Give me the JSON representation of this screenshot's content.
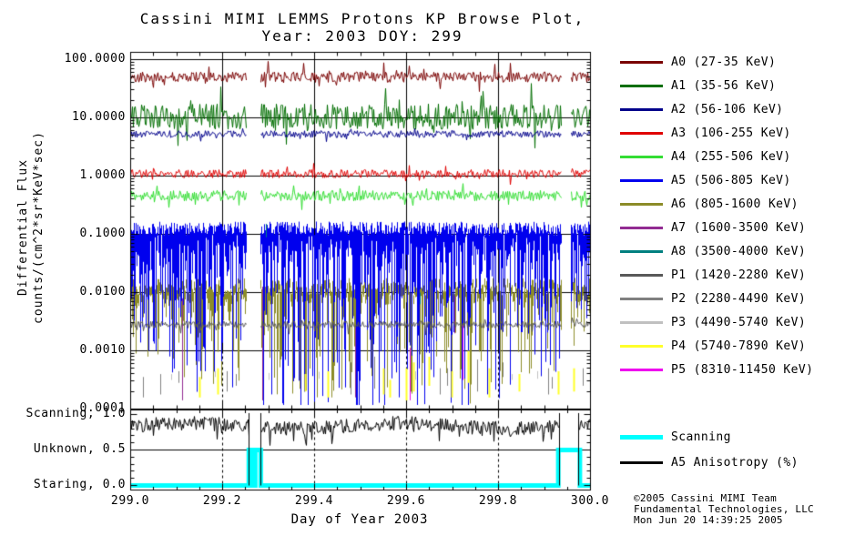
{
  "title": {
    "line1": "Cassini MIMI LEMMS Protons KP Browse Plot,",
    "line2": "Year: 2003 DOY: 299"
  },
  "axes": {
    "y_label_line1": "Differential Flux",
    "y_label_line2": "counts/(cm^2*sr*KeV*sec)",
    "x_label": "Day of Year 2003",
    "y_ticks": [
      "100.0000",
      "10.0000",
      "1.0000",
      "0.1000",
      "0.0100",
      "0.0010",
      "0.0001"
    ],
    "x_ticks": [
      "299.0",
      "299.2",
      "299.4",
      "299.6",
      "299.8",
      "300.0"
    ],
    "state_ticks": [
      "Scanning, 1.0",
      "Unknown, 0.5",
      "Staring, 0.0"
    ]
  },
  "legend": {
    "items": [
      {
        "label": "A0 (27-35 KeV)",
        "color": "#7A0000"
      },
      {
        "label": "A1 (35-56 KeV)",
        "color": "#006E00"
      },
      {
        "label": "A2 (56-106 KeV)",
        "color": "#00008B"
      },
      {
        "label": "A3 (106-255 KeV)",
        "color": "#E00000"
      },
      {
        "label": "A4 (255-506 KeV)",
        "color": "#33DD33"
      },
      {
        "label": "A5 (506-805 KeV)",
        "color": "#0000EE"
      },
      {
        "label": "A6 (805-1600 KeV)",
        "color": "#8C8C28"
      },
      {
        "label": "A7 (1600-3500 KeV)",
        "color": "#922B92"
      },
      {
        "label": "A8 (3500-4000 KeV)",
        "color": "#008080"
      },
      {
        "label": "P1 (1420-2280 KeV)",
        "color": "#595959"
      },
      {
        "label": "P2 (2280-4490 KeV)",
        "color": "#808080"
      },
      {
        "label": "P3 (4490-5740 KeV)",
        "color": "#C0C0C0"
      },
      {
        "label": "P4 (5740-7890 KeV)",
        "color": "#FFFF2A"
      },
      {
        "label": "P5 (8310-11450 KeV)",
        "color": "#EE00EE"
      }
    ]
  },
  "state_legend": {
    "items": [
      {
        "label": "Scanning",
        "color": "#00FFFF",
        "thickness": 5
      },
      {
        "label": "A5 Anisotropy (%)",
        "color": "#000000",
        "thickness": 3
      }
    ]
  },
  "footer": {
    "line1": "©2005 Cassini MIMI Team",
    "line2": "Fundamental Technologies, LLC",
    "line3": "Mon Jun 20 14:39:25 2005"
  },
  "chart_data": [
    {
      "type": "line",
      "name": "differential-flux-panel",
      "title": "Cassini MIMI LEMMS Protons KP Browse Plot, Year: 2003 DOY: 299",
      "xlabel": "Day of Year 2003",
      "ylabel": "Differential Flux counts/(cm^2*sr*KeV*sec)",
      "y_scale": "log",
      "x_range": [
        299.0,
        300.0
      ],
      "y_range": [
        0.0001,
        130
      ],
      "x_major_ticks": [
        299.0,
        299.2,
        299.4,
        299.6,
        299.8,
        300.0
      ],
      "x_minor_step": 0.05,
      "grid_x": [
        299.2,
        299.4,
        299.6,
        299.8
      ],
      "grid_y": [
        100,
        10,
        1,
        0.1,
        0.01,
        0.001
      ],
      "data_gaps": [
        [
          299.252,
          299.282
        ],
        [
          299.937,
          299.958
        ]
      ],
      "series": [
        {
          "name": "A6 (805-1600 KeV)",
          "color": "#8C8C28",
          "render": "spike_train",
          "log_top": -1.9,
          "top_jitter": 0.15,
          "min_depth": 0.2,
          "max_depth": 1.8,
          "density": 0.6
        },
        {
          "name": "A5 (506-805 KeV)",
          "color": "#0000EE",
          "render": "spike_train",
          "log_top": -0.9,
          "top_jitter": 0.12,
          "min_depth": 0.3,
          "max_depth": 3.0,
          "density": 0.93
        },
        {
          "name": "A7 (1600-3500 KeV)",
          "color": "#922B92",
          "render": "vlines",
          "lines": [
            [
              299.113,
              -3.85,
              -2.1
            ],
            [
              299.287,
              -3.85,
              -1.9
            ],
            [
              299.705,
              -2.7,
              -2.05
            ],
            [
              299.49,
              -3.8,
              -2.6
            ]
          ]
        },
        {
          "name": "A8 (3500-4000 KeV)",
          "color": "#008080",
          "render": "vlines",
          "lines": [
            [
              299.296,
              -1.05,
              -0.82
            ],
            [
              299.63,
              -2.2,
              -2.0
            ]
          ]
        },
        {
          "name": "P5 (8310-11450 KeV)",
          "color": "#EE00EE",
          "render": "vlines",
          "lines": [
            [
              299.608,
              -3.85,
              -2.95
            ],
            [
              299.722,
              -3.5,
              -2.55
            ]
          ]
        },
        {
          "name": "P2 (2280-4490 KeV)",
          "color": "#808080",
          "render": "vlines",
          "lines": [
            [
              299.028,
              -3.8,
              -3.45
            ],
            [
              299.065,
              -3.75,
              -3.4
            ],
            [
              299.105,
              -3.55,
              -3.35
            ],
            [
              299.21,
              -3.7,
              -3.35
            ],
            [
              299.23,
              -3.6,
              -3.4
            ],
            [
              299.48,
              -3.75,
              -3.2
            ],
            [
              299.53,
              -3.65,
              -3.1
            ],
            [
              299.674,
              -3.75,
              -3.3
            ],
            [
              299.69,
              -3.6,
              -3.3
            ],
            [
              299.755,
              -3.7,
              -3.15
            ],
            [
              299.81,
              -3.45,
              -3.2
            ],
            [
              299.908,
              -3.75,
              -3.3
            ],
            [
              299.916,
              -3.65,
              -3.45
            ],
            [
              299.985,
              -3.6,
              -3.3
            ]
          ]
        },
        {
          "name": "P3 (4490-5740 KeV)",
          "color": "#C0C0C0",
          "render": "vlines",
          "lines": [
            [
              299.09,
              -3.5,
              -3.4
            ],
            [
              299.185,
              -3.45,
              -3.35
            ],
            [
              299.3,
              -3.5,
              -3.38
            ],
            [
              299.41,
              -3.48,
              -3.36
            ],
            [
              299.62,
              -3.5,
              -3.35
            ],
            [
              299.735,
              -3.45,
              -3.3
            ],
            [
              299.83,
              -3.5,
              -3.4
            ],
            [
              299.885,
              -3.48,
              -3.35
            ]
          ]
        },
        {
          "name": "P4 (5740-7890 KeV)",
          "color": "#FFFF2A",
          "render": "vlines",
          "width": 2,
          "lines": [
            [
              299.15,
              -3.8,
              -3.45
            ],
            [
              299.19,
              -3.75,
              -3.3
            ],
            [
              299.38,
              -3.7,
              -3.4
            ],
            [
              299.43,
              -3.8,
              -3.35
            ],
            [
              299.55,
              -3.75,
              -3.3
            ],
            [
              299.565,
              -3.8,
              -3.5
            ],
            [
              299.6,
              -3.85,
              -3.3
            ],
            [
              299.615,
              -3.7,
              -3.2
            ],
            [
              299.65,
              -3.6,
              -3.1
            ],
            [
              299.7,
              -3.8,
              -3.35
            ],
            [
              299.735,
              -3.55,
              -3.0
            ],
            [
              299.78,
              -3.8,
              -3.3
            ],
            [
              299.845,
              -3.7,
              -3.4
            ],
            [
              299.93,
              -3.75,
              -3.35
            ],
            [
              299.965,
              -3.7,
              -3.3
            ]
          ]
        },
        {
          "name": "P1 (1420-2280 KeV)",
          "color": "#595959",
          "render": "noisy_line",
          "log_level": -2.55,
          "log_jitter": 0.06
        },
        {
          "name": "A0 (27-35 KeV)",
          "color": "#7A0000",
          "render": "noisy_line",
          "log_level": 1.7,
          "log_jitter": 0.09
        },
        {
          "name": "A1 (35-56 KeV)",
          "color": "#006E00",
          "render": "noisy_line",
          "log_level": 1.02,
          "log_jitter": 0.22
        },
        {
          "name": "A2 (56-106 KeV)",
          "color": "#00008B",
          "render": "noisy_line",
          "log_level": 0.72,
          "log_jitter": 0.06
        },
        {
          "name": "A3 (106-255 KeV)",
          "color": "#E00000",
          "render": "noisy_line",
          "log_level": 0.04,
          "log_jitter": 0.07
        },
        {
          "name": "A4 (255-506 KeV)",
          "color": "#33DD33",
          "render": "noisy_line",
          "log_level": -0.34,
          "log_jitter": 0.09
        }
      ]
    },
    {
      "type": "line",
      "name": "pointing-state-panel",
      "x_range": [
        299.0,
        300.0
      ],
      "y_range": [
        0,
        1
      ],
      "y_major": [
        0,
        0.5,
        1.0
      ],
      "y_minor_step": 0.1,
      "grid_y": [
        0.5
      ],
      "grid_x_dashed": [
        299.2,
        299.4,
        299.6,
        299.8
      ],
      "series": [
        {
          "name": "Scanning state",
          "color": "#00FFFF",
          "render": "step",
          "width": 5,
          "segments": [
            [
              299.0,
              299.257,
              0
            ],
            [
              299.257,
              299.266,
              0.5
            ],
            [
              299.266,
              299.271,
              0
            ],
            [
              299.271,
              299.283,
              0.5
            ],
            [
              299.283,
              299.93,
              0
            ],
            [
              299.93,
              299.977,
              0.5
            ],
            [
              299.977,
              300.0,
              0
            ]
          ]
        },
        {
          "name": "A5 Anisotropy (%)",
          "color": "#000000",
          "render": "noisy_line_linear",
          "center": 0.84,
          "jitter": 0.1,
          "clip": [
            0.56,
            1.04
          ],
          "gaps": [
            [
              299.258,
              299.284
            ],
            [
              299.932,
              299.975
            ]
          ]
        }
      ]
    }
  ]
}
